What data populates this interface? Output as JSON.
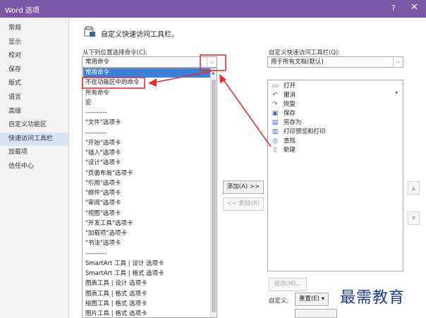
{
  "window": {
    "title": "Word 选项",
    "help": "?",
    "close": "✕"
  },
  "nav": [
    "常规",
    "显示",
    "校对",
    "保存",
    "版式",
    "语言",
    "高级",
    "自定义功能区",
    "快速访问工具栏",
    "加载项",
    "信任中心"
  ],
  "nav_active_index": 8,
  "header": {
    "title": "自定义快速访问工具栏。"
  },
  "left": {
    "label": "从下列位置选择命令(C):",
    "combo_value": "常用命令",
    "items": [
      "常用命令",
      "不在功能区中的命令",
      "所有命令",
      "宏",
      "----------",
      "\"文件\"选项卡",
      "----------",
      "\"开始\"选项卡",
      "\"插入\"选项卡",
      "\"设计\"选项卡",
      "\"页面布局\"选项卡",
      "\"引用\"选项卡",
      "\"邮件\"选项卡",
      "\"审阅\"选项卡",
      "\"视图\"选项卡",
      "\"开发工具\"选项卡",
      "\"加载项\"选项卡",
      "\"书法\"选项卡",
      "----------",
      "SmartArt 工具 | 设计 选项卡",
      "SmartArt 工具 | 格式 选项卡",
      "图表工具 | 设计 选项卡",
      "图表工具 | 格式 选项卡",
      "绘图工具 | 格式 选项卡",
      "图片工具 | 格式 选项卡"
    ]
  },
  "middle": {
    "add": "添加(A) >>",
    "remove": "<< 删除(R)"
  },
  "right": {
    "label": "自定义快速访问工具栏(Q):",
    "combo_value": "用于所有文档(默认)",
    "items": [
      {
        "label": "打开",
        "icon": "folder-icon"
      },
      {
        "label": "撤消",
        "icon": "undo-icon"
      },
      {
        "label": "恢复",
        "icon": "redo-icon"
      },
      {
        "label": "保存",
        "icon": "save-icon"
      },
      {
        "label": "另存为",
        "icon": "save-as-icon"
      },
      {
        "label": "打印预览和打印",
        "icon": "print-preview-icon"
      },
      {
        "label": "查找",
        "icon": "binoculars-icon"
      },
      {
        "label": "新建",
        "icon": "new-document-icon"
      }
    ],
    "modify": "修改(M)...",
    "custom_label": "自定义:",
    "reset": "重置(E) ▾"
  },
  "watermark": "最需教育",
  "colors": {
    "titlebar": "#7b58a6",
    "selection": "#3c7fd8",
    "annotation": "#e03030",
    "watermark": "#1e3d8f"
  }
}
